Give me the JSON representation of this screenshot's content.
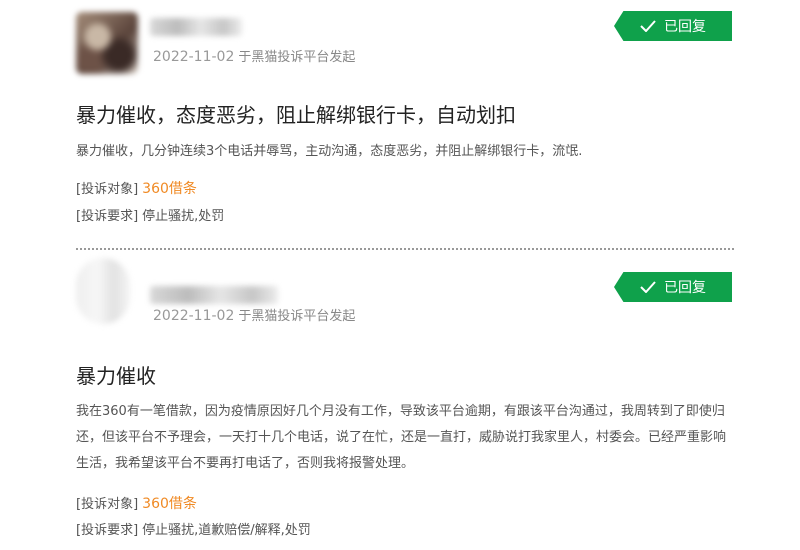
{
  "posts": [
    {
      "date": "2022-11-02",
      "source": "于黑猫投诉平台发起",
      "status": "已回复",
      "title": "暴力催收，态度恶劣，阻止解绑银行卡，自动划扣",
      "content": "暴力催收，几分钟连续3个电话并辱骂，主动沟通，态度恶劣，并阻止解绑银行卡，流氓.",
      "target_label": "[投诉对象]",
      "target_value": "360借条",
      "demand_label": "[投诉要求]",
      "demand_value": "停止骚扰,处罚"
    },
    {
      "date": "2022-11-02",
      "source": "于黑猫投诉平台发起",
      "status": "已回复",
      "title": "暴力催收",
      "content": "我在360有一笔借款，因为疫情原因好几个月没有工作，导致该平台逾期，有跟该平台沟通过，我周转到了即使归还，但该平台不予理会，一天打十几个电话，说了在忙，还是一直打，威胁说打我家里人，村委会。已经严重影响生活，我希望该平台不要再打电话了，否则我将报警处理。",
      "target_label": "[投诉对象]",
      "target_value": "360借条",
      "demand_label": "[投诉要求]",
      "demand_value": "停止骚扰,道歉赔偿/解释,处罚"
    }
  ],
  "colors": {
    "badge": "#0fa14b",
    "target": "#f08a24"
  },
  "icons": {
    "status": "check-icon"
  }
}
